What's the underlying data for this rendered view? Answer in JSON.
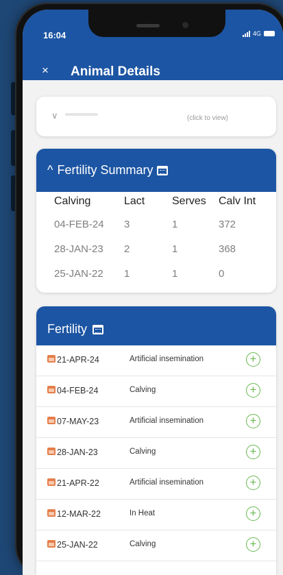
{
  "status_bar": {
    "time": "16:04",
    "network": "4G"
  },
  "header": {
    "close_label": "×",
    "title": "Animal Details"
  },
  "collapsed_section": {
    "hint": "(click to view)"
  },
  "fertility_summary": {
    "title": "Fertility Summary",
    "expand_glyph": "^",
    "columns": [
      "Calving",
      "Lact",
      "Serves",
      "Calv Int"
    ],
    "rows": [
      [
        "04-FEB-24",
        "3",
        "1",
        "372"
      ],
      [
        "28-JAN-23",
        "2",
        "1",
        "368"
      ],
      [
        "25-JAN-22",
        "1",
        "1",
        "0"
      ]
    ]
  },
  "fertility": {
    "title": "Fertility",
    "add_label": "+",
    "events": [
      {
        "date": "21-APR-24",
        "event": "Artificial insemination"
      },
      {
        "date": "04-FEB-24",
        "event": "Calving"
      },
      {
        "date": "07-MAY-23",
        "event": "Artificial insemination"
      },
      {
        "date": "28-JAN-23",
        "event": "Calving"
      },
      {
        "date": "21-APR-22",
        "event": "Artificial insemination"
      },
      {
        "date": "12-MAR-22",
        "event": "In Heat"
      },
      {
        "date": "25-JAN-22",
        "event": "Calving"
      }
    ]
  },
  "colors": {
    "primary": "#1c55a3",
    "add_icon": "#67b84e",
    "event_icon": "#e47e4a"
  }
}
